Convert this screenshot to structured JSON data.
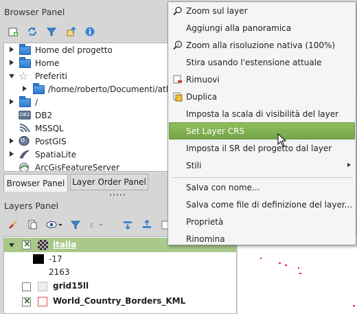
{
  "browser_panel": {
    "title": "Browser Panel",
    "tree": [
      {
        "label": "Home del progetto",
        "icon": "folder-icon",
        "expand": "right"
      },
      {
        "label": "Home",
        "icon": "folder-icon",
        "expand": "right"
      },
      {
        "label": "Preferiti",
        "icon": "star-icon",
        "expand": "down"
      },
      {
        "label": "/home/roberto/Documenti/atla",
        "icon": "folder-icon",
        "expand": "right"
      },
      {
        "label": "/",
        "icon": "folder-icon",
        "expand": "right"
      },
      {
        "label": "DB2",
        "icon": "db2-icon",
        "expand": ""
      },
      {
        "label": "MSSQL",
        "icon": "mssql-icon",
        "expand": ""
      },
      {
        "label": "PostGIS",
        "icon": "postgis-icon",
        "expand": "right"
      },
      {
        "label": "SpatiaLite",
        "icon": "spatialite-icon",
        "expand": "right"
      },
      {
        "label": "ArcGisFeatureServer",
        "icon": "arcgis-icon",
        "expand": ""
      }
    ],
    "db2_badge": "DB2"
  },
  "tabs": {
    "browser": "Browser Panel",
    "layer_order": "Layer Order Panel"
  },
  "layers_panel": {
    "title": "Layers Panel",
    "layers": {
      "italia": {
        "name": "italia",
        "checked": true
      },
      "legend": [
        {
          "label": "-17",
          "color": "#000000"
        },
        {
          "label": "2163",
          "color": "#ffffff"
        }
      ],
      "grid": {
        "name": "grid15ll",
        "checked": false
      },
      "borders": {
        "name": "World_Country_Borders_KML",
        "checked": true
      }
    }
  },
  "context_menu": {
    "items": [
      {
        "label": "Zoom sul layer",
        "icon": "zoom-layer-icon"
      },
      {
        "label": "Aggiungi alla panoramica",
        "icon": ""
      },
      {
        "label": "Zoom alla risoluzione nativa (100%)",
        "icon": "zoom-native-icon"
      },
      {
        "label": "Stira usando l'estensione attuale",
        "icon": ""
      },
      {
        "label": "Rimuovi",
        "icon": "remove-layer-icon"
      },
      {
        "label": "Duplica",
        "icon": "duplicate-layer-icon"
      },
      {
        "label": "Imposta la scala di visibilità del layer",
        "icon": ""
      },
      {
        "label": "Set Layer CRS",
        "icon": "",
        "highlighted": true
      },
      {
        "label": "Imposta il SR del progetto dal layer",
        "icon": ""
      },
      {
        "label": "Stili",
        "icon": "",
        "submenu": true
      },
      {
        "label": "Salva con nome...",
        "icon": ""
      },
      {
        "label": "Salva come file di definizione del layer...",
        "icon": ""
      },
      {
        "label": "Proprietà",
        "icon": ""
      },
      {
        "label": "Rinomina",
        "icon": ""
      }
    ]
  },
  "colors": {
    "highlight": "#7fae52",
    "folder": "#2d7bd1",
    "map_feature": "#e02020"
  }
}
